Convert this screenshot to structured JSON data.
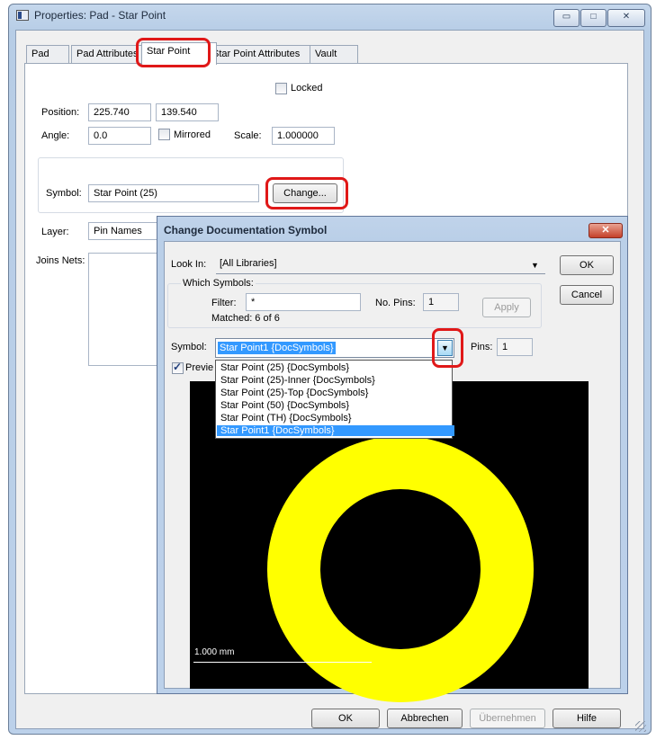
{
  "window": {
    "title": "Properties: Pad - Star Point",
    "minimize": "▭",
    "maximize": "□",
    "close": "✕"
  },
  "tabs": [
    "Pad",
    "Pad Attributes",
    "Star Point",
    "Star Point Attributes",
    "Vault"
  ],
  "star_point": {
    "locked_label": "Locked",
    "position_label": "Position:",
    "position_x": "225.740",
    "position_y": "139.540",
    "angle_label": "Angle:",
    "angle_value": "0.0",
    "mirrored_label": "Mirrored",
    "scale_label": "Scale:",
    "scale_value": "1.000000",
    "symbol_label": "Symbol:",
    "symbol_value": "Star Point (25)",
    "change_button": "Change...",
    "layer_label": "Layer:",
    "layer_value": "Pin Names",
    "joins_nets_label": "Joins Nets:"
  },
  "footer": {
    "ok": "OK",
    "cancel": "Abbrechen",
    "apply": "Übernehmen",
    "help": "Hilfe"
  },
  "change_dialog": {
    "title": "Change Documentation Symbol",
    "close": "✕",
    "look_in_label": "Look In:",
    "look_in_value": "[All Libraries]",
    "ok": "OK",
    "cancel": "Cancel",
    "which_symbols_label": "Which Symbols:",
    "filter_label": "Filter:",
    "filter_value": "*",
    "no_pins_label": "No. Pins:",
    "no_pins_value": "1",
    "apply": "Apply",
    "matched": "Matched: 6 of 6",
    "symbol_label": "Symbol:",
    "symbol_value": "Star Point1 {DocSymbols}",
    "pins_label": "Pins:",
    "pins_value": "1",
    "preview_label": "Previe",
    "scale_text": "1.000 mm",
    "dropdown_items": [
      "Star Point (25) {DocSymbols}",
      "Star Point (25)-Inner {DocSymbols}",
      "Star Point (25)-Top {DocSymbols}",
      "Star Point (50) {DocSymbols}",
      "Star Point (TH) {DocSymbols}",
      "Star Point1 {DocSymbols}"
    ]
  },
  "colors": {
    "highlight": "#e01818",
    "selection": "#3399ff",
    "preview_ring": "#ffff00",
    "preview_bg": "#000000"
  }
}
